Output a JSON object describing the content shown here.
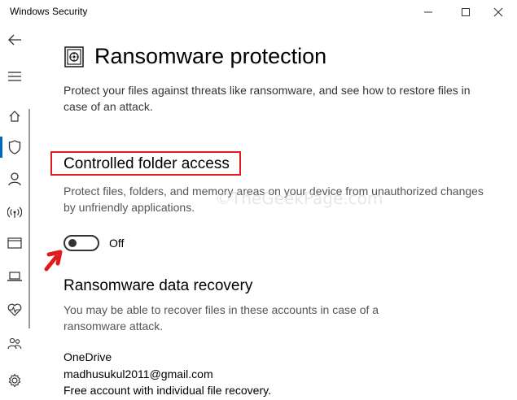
{
  "window": {
    "title": "Windows Security"
  },
  "sidebar": {
    "items": [
      {
        "icon": "back-arrow-icon"
      },
      {
        "icon": "hamburger-menu-icon"
      },
      {
        "icon": "home-icon"
      },
      {
        "icon": "shield-icon",
        "active": true
      },
      {
        "icon": "person-icon"
      },
      {
        "icon": "wireless-icon"
      },
      {
        "icon": "app-browser-icon"
      },
      {
        "icon": "laptop-icon"
      },
      {
        "icon": "heart-pulse-icon"
      },
      {
        "icon": "family-icon"
      },
      {
        "icon": "gear-icon"
      }
    ]
  },
  "page": {
    "title": "Ransomware protection",
    "description": "Protect your files against threats like ransomware, and see how to restore files in case of an attack."
  },
  "controlled_folder_access": {
    "heading": "Controlled folder access",
    "description": "Protect files, folders, and memory areas on your device from unauthorized changes by unfriendly applications.",
    "toggle_state": "Off"
  },
  "watermark": "©TheGeekPage.com",
  "recovery": {
    "heading": "Ransomware data recovery",
    "description": "You may be able to recover files in these accounts in case of a ransomware attack.",
    "provider": "OneDrive",
    "email": "madhusukul2011@gmail.com",
    "plan": "Free account with individual file recovery."
  },
  "colors": {
    "accent": "#0067c0",
    "highlight": "#e11b1b"
  }
}
